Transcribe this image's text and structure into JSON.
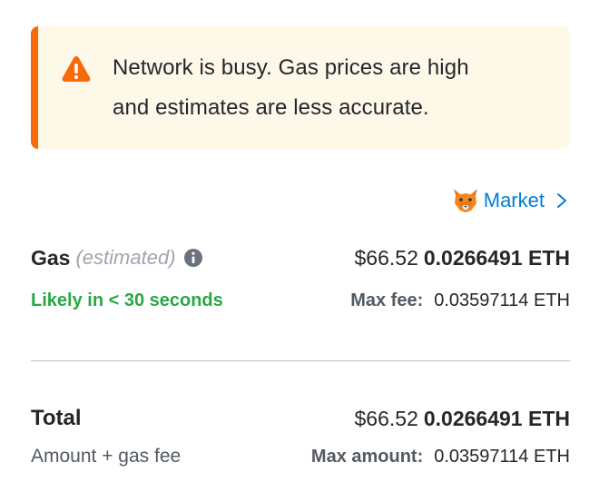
{
  "alert": {
    "icon": "warning-icon",
    "line1": "Network is busy. Gas prices are high",
    "line2": "and estimates are less accurate.",
    "colors": {
      "border": "#f66a0a",
      "background": "#fef8e9"
    }
  },
  "market": {
    "icon": "fox-icon",
    "label": "Market",
    "chevron": "chevron-right-icon"
  },
  "gas": {
    "label": "Gas",
    "sublabel": "(estimated)",
    "info_icon": "info-icon",
    "fiat": "$66.52",
    "eth": "0.0266491 ETH",
    "likely": "Likely in < 30 seconds",
    "max_fee_label": "Max fee:",
    "max_fee_value": "0.03597114 ETH"
  },
  "total": {
    "label": "Total",
    "fiat": "$66.52",
    "eth": "0.0266491 ETH",
    "sublabel": "Amount + gas fee",
    "max_amount_label": "Max amount:",
    "max_amount_value": "0.03597114 ETH"
  },
  "colors": {
    "link": "#037dd6",
    "success": "#28a745",
    "warning": "#f66a0a"
  }
}
